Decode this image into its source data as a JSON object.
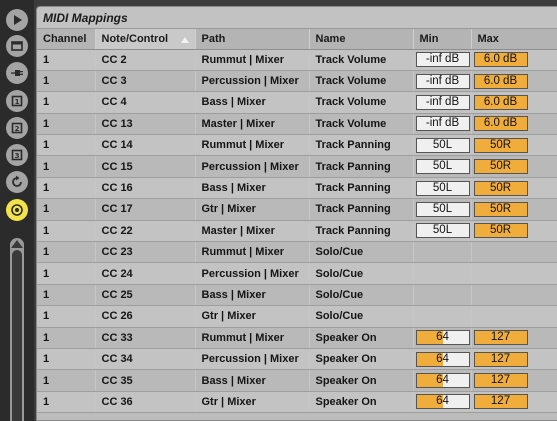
{
  "sidebar": {
    "buttons": [
      {
        "name": "play-icon"
      },
      {
        "name": "window-icon"
      },
      {
        "name": "plug-icon"
      },
      {
        "name": "browser-slot-1-icon"
      },
      {
        "name": "browser-slot-2-icon"
      },
      {
        "name": "browser-slot-3-icon"
      },
      {
        "name": "refresh-icon"
      },
      {
        "name": "target-icon",
        "active": true
      }
    ],
    "active_color": "#f3e24a"
  },
  "panel": {
    "title": "MIDI Mappings"
  },
  "table": {
    "columns": [
      "Channel",
      "Note/Control",
      "Path",
      "Name",
      "Min",
      "Max"
    ],
    "sorted_column": "Note/Control",
    "accent_color": "#f1ad3c",
    "rows": [
      {
        "channel": "1",
        "control": "CC 2",
        "path": "Rummut | Mixer",
        "name": "Track Volume",
        "min": "-inf dB",
        "max": "6.0 dB"
      },
      {
        "channel": "1",
        "control": "CC 3",
        "path": "Percussion | Mixer",
        "name": "Track Volume",
        "min": "-inf dB",
        "max": "6.0 dB"
      },
      {
        "channel": "1",
        "control": "CC 4",
        "path": "Bass | Mixer",
        "name": "Track Volume",
        "min": "-inf dB",
        "max": "6.0 dB"
      },
      {
        "channel": "1",
        "control": "CC 13",
        "path": "Master | Mixer",
        "name": "Track Volume",
        "min": "-inf dB",
        "max": "6.0 dB"
      },
      {
        "channel": "1",
        "control": "CC 14",
        "path": "Rummut | Mixer",
        "name": "Track Panning",
        "min": "50L",
        "max": "50R"
      },
      {
        "channel": "1",
        "control": "CC 15",
        "path": "Percussion | Mixer",
        "name": "Track Panning",
        "min": "50L",
        "max": "50R"
      },
      {
        "channel": "1",
        "control": "CC 16",
        "path": "Bass | Mixer",
        "name": "Track Panning",
        "min": "50L",
        "max": "50R"
      },
      {
        "channel": "1",
        "control": "CC 17",
        "path": "Gtr | Mixer",
        "name": "Track Panning",
        "min": "50L",
        "max": "50R"
      },
      {
        "channel": "1",
        "control": "CC 22",
        "path": "Master | Mixer",
        "name": "Track Panning",
        "min": "50L",
        "max": "50R"
      },
      {
        "channel": "1",
        "control": "CC 23",
        "path": "Rummut | Mixer",
        "name": "Solo/Cue",
        "min": "",
        "max": ""
      },
      {
        "channel": "1",
        "control": "CC 24",
        "path": "Percussion | Mixer",
        "name": "Solo/Cue",
        "min": "",
        "max": ""
      },
      {
        "channel": "1",
        "control": "CC 25",
        "path": "Bass | Mixer",
        "name": "Solo/Cue",
        "min": "",
        "max": ""
      },
      {
        "channel": "1",
        "control": "CC 26",
        "path": "Gtr | Mixer",
        "name": "Solo/Cue",
        "min": "",
        "max": ""
      },
      {
        "channel": "1",
        "control": "CC 33",
        "path": "Rummut | Mixer",
        "name": "Speaker On",
        "min": "64",
        "max": "127",
        "min_fill": 0.5
      },
      {
        "channel": "1",
        "control": "CC 34",
        "path": "Percussion | Mixer",
        "name": "Speaker On",
        "min": "64",
        "max": "127",
        "min_fill": 0.5
      },
      {
        "channel": "1",
        "control": "CC 35",
        "path": "Bass | Mixer",
        "name": "Speaker On",
        "min": "64",
        "max": "127",
        "min_fill": 0.5
      },
      {
        "channel": "1",
        "control": "CC 36",
        "path": "Gtr | Mixer",
        "name": "Speaker On",
        "min": "64",
        "max": "127",
        "min_fill": 0.5
      }
    ]
  }
}
